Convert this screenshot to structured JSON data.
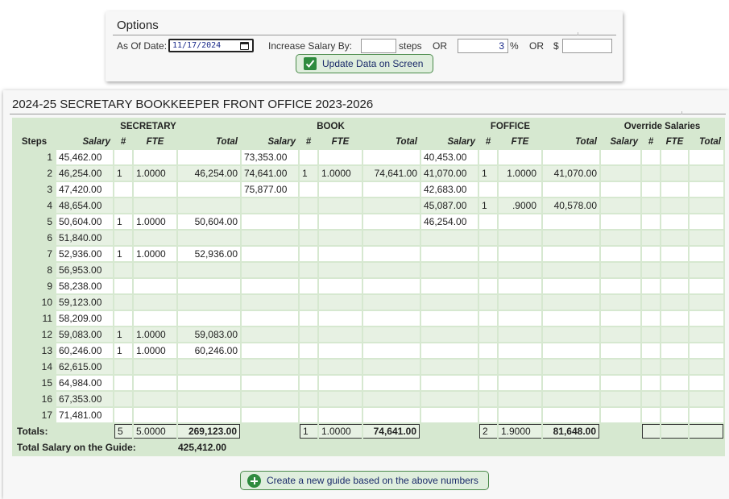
{
  "options": {
    "title": "Options",
    "as_of_date_label": "As Of Date:",
    "as_of_date_value": "11/17/2024",
    "increase_label": "Increase Salary By:",
    "steps_value": "",
    "steps_label": "steps",
    "or1": "OR",
    "percent_value": "3",
    "percent_label": "%",
    "or2": "OR",
    "dollar_label": "$",
    "dollar_value": "",
    "update_button": "Update Data on Screen",
    "icons": {
      "update": "check-icon",
      "date": "calendar-icon"
    }
  },
  "guide": {
    "title": "2024-25 SECRETARY BOOKKEEPER FRONT OFFICE 2023-2026",
    "groups": [
      "SECRETARY",
      "BOOK",
      "FOFFICE",
      "Override Salaries"
    ],
    "col_headers": {
      "steps": "Steps",
      "salary": "Salary",
      "num": "#",
      "fte": "FTE",
      "total": "Total"
    },
    "rows": [
      {
        "step": "1",
        "sec": [
          "45,462.00",
          "",
          "",
          ""
        ],
        "book": [
          "73,353.00",
          "",
          "",
          ""
        ],
        "off": [
          "40,453.00",
          "",
          "",
          ""
        ]
      },
      {
        "step": "2",
        "sec": [
          "46,254.00",
          "1",
          "1.0000",
          "46,254.00"
        ],
        "book": [
          "74,641.00",
          "1",
          "1.0000",
          "74,641.00"
        ],
        "off": [
          "41,070.00",
          "1",
          "1.0000",
          "41,070.00"
        ]
      },
      {
        "step": "3",
        "sec": [
          "47,420.00",
          "",
          "",
          ""
        ],
        "book": [
          "75,877.00",
          "",
          "",
          ""
        ],
        "off": [
          "42,683.00",
          "",
          "",
          ""
        ]
      },
      {
        "step": "4",
        "sec": [
          "48,654.00",
          "",
          "",
          ""
        ],
        "book": [
          "",
          "",
          "",
          ""
        ],
        "off": [
          "45,087.00",
          "1",
          ".9000",
          "40,578.00"
        ]
      },
      {
        "step": "5",
        "sec": [
          "50,604.00",
          "1",
          "1.0000",
          "50,604.00"
        ],
        "book": [
          "",
          "",
          "",
          ""
        ],
        "off": [
          "46,254.00",
          "",
          "",
          ""
        ]
      },
      {
        "step": "6",
        "sec": [
          "51,840.00",
          "",
          "",
          ""
        ],
        "book": [
          "",
          "",
          "",
          ""
        ],
        "off": [
          "",
          "",
          "",
          ""
        ]
      },
      {
        "step": "7",
        "sec": [
          "52,936.00",
          "1",
          "1.0000",
          "52,936.00"
        ],
        "book": [
          "",
          "",
          "",
          ""
        ],
        "off": [
          "",
          "",
          "",
          ""
        ]
      },
      {
        "step": "8",
        "sec": [
          "56,953.00",
          "",
          "",
          ""
        ],
        "book": [
          "",
          "",
          "",
          ""
        ],
        "off": [
          "",
          "",
          "",
          ""
        ]
      },
      {
        "step": "9",
        "sec": [
          "58,238.00",
          "",
          "",
          ""
        ],
        "book": [
          "",
          "",
          "",
          ""
        ],
        "off": [
          "",
          "",
          "",
          ""
        ]
      },
      {
        "step": "10",
        "sec": [
          "59,123.00",
          "",
          "",
          ""
        ],
        "book": [
          "",
          "",
          "",
          ""
        ],
        "off": [
          "",
          "",
          "",
          ""
        ]
      },
      {
        "step": "11",
        "sec": [
          "58,209.00",
          "",
          "",
          ""
        ],
        "book": [
          "",
          "",
          "",
          ""
        ],
        "off": [
          "",
          "",
          "",
          ""
        ]
      },
      {
        "step": "12",
        "sec": [
          "59,083.00",
          "1",
          "1.0000",
          "59,083.00"
        ],
        "book": [
          "",
          "",
          "",
          ""
        ],
        "off": [
          "",
          "",
          "",
          ""
        ]
      },
      {
        "step": "13",
        "sec": [
          "60,246.00",
          "1",
          "1.0000",
          "60,246.00"
        ],
        "book": [
          "",
          "",
          "",
          ""
        ],
        "off": [
          "",
          "",
          "",
          ""
        ]
      },
      {
        "step": "14",
        "sec": [
          "62,615.00",
          "",
          "",
          ""
        ],
        "book": [
          "",
          "",
          "",
          ""
        ],
        "off": [
          "",
          "",
          "",
          ""
        ]
      },
      {
        "step": "15",
        "sec": [
          "64,984.00",
          "",
          "",
          ""
        ],
        "book": [
          "",
          "",
          "",
          ""
        ],
        "off": [
          "",
          "",
          "",
          ""
        ]
      },
      {
        "step": "16",
        "sec": [
          "67,353.00",
          "",
          "",
          ""
        ],
        "book": [
          "",
          "",
          "",
          ""
        ],
        "off": [
          "",
          "",
          "",
          ""
        ]
      },
      {
        "step": "17",
        "sec": [
          "71,481.00",
          "",
          "",
          ""
        ],
        "book": [
          "",
          "",
          "",
          ""
        ],
        "off": [
          "",
          "",
          "",
          ""
        ]
      }
    ],
    "totals": {
      "label": "Totals:",
      "sec": {
        "num": "5",
        "fte": "5.0000",
        "total": "269,123.00"
      },
      "book": {
        "num": "1",
        "fte": "1.0000",
        "total": "74,641.00"
      },
      "off": {
        "num": "2",
        "fte": "1.9000",
        "total": "81,648.00"
      }
    },
    "grand_total_label": "Total Salary on the Guide:",
    "grand_total_value": "425,412.00",
    "create_button": "Create a new guide based on the above numbers",
    "icons": {
      "create": "plus-circle-icon"
    }
  }
}
